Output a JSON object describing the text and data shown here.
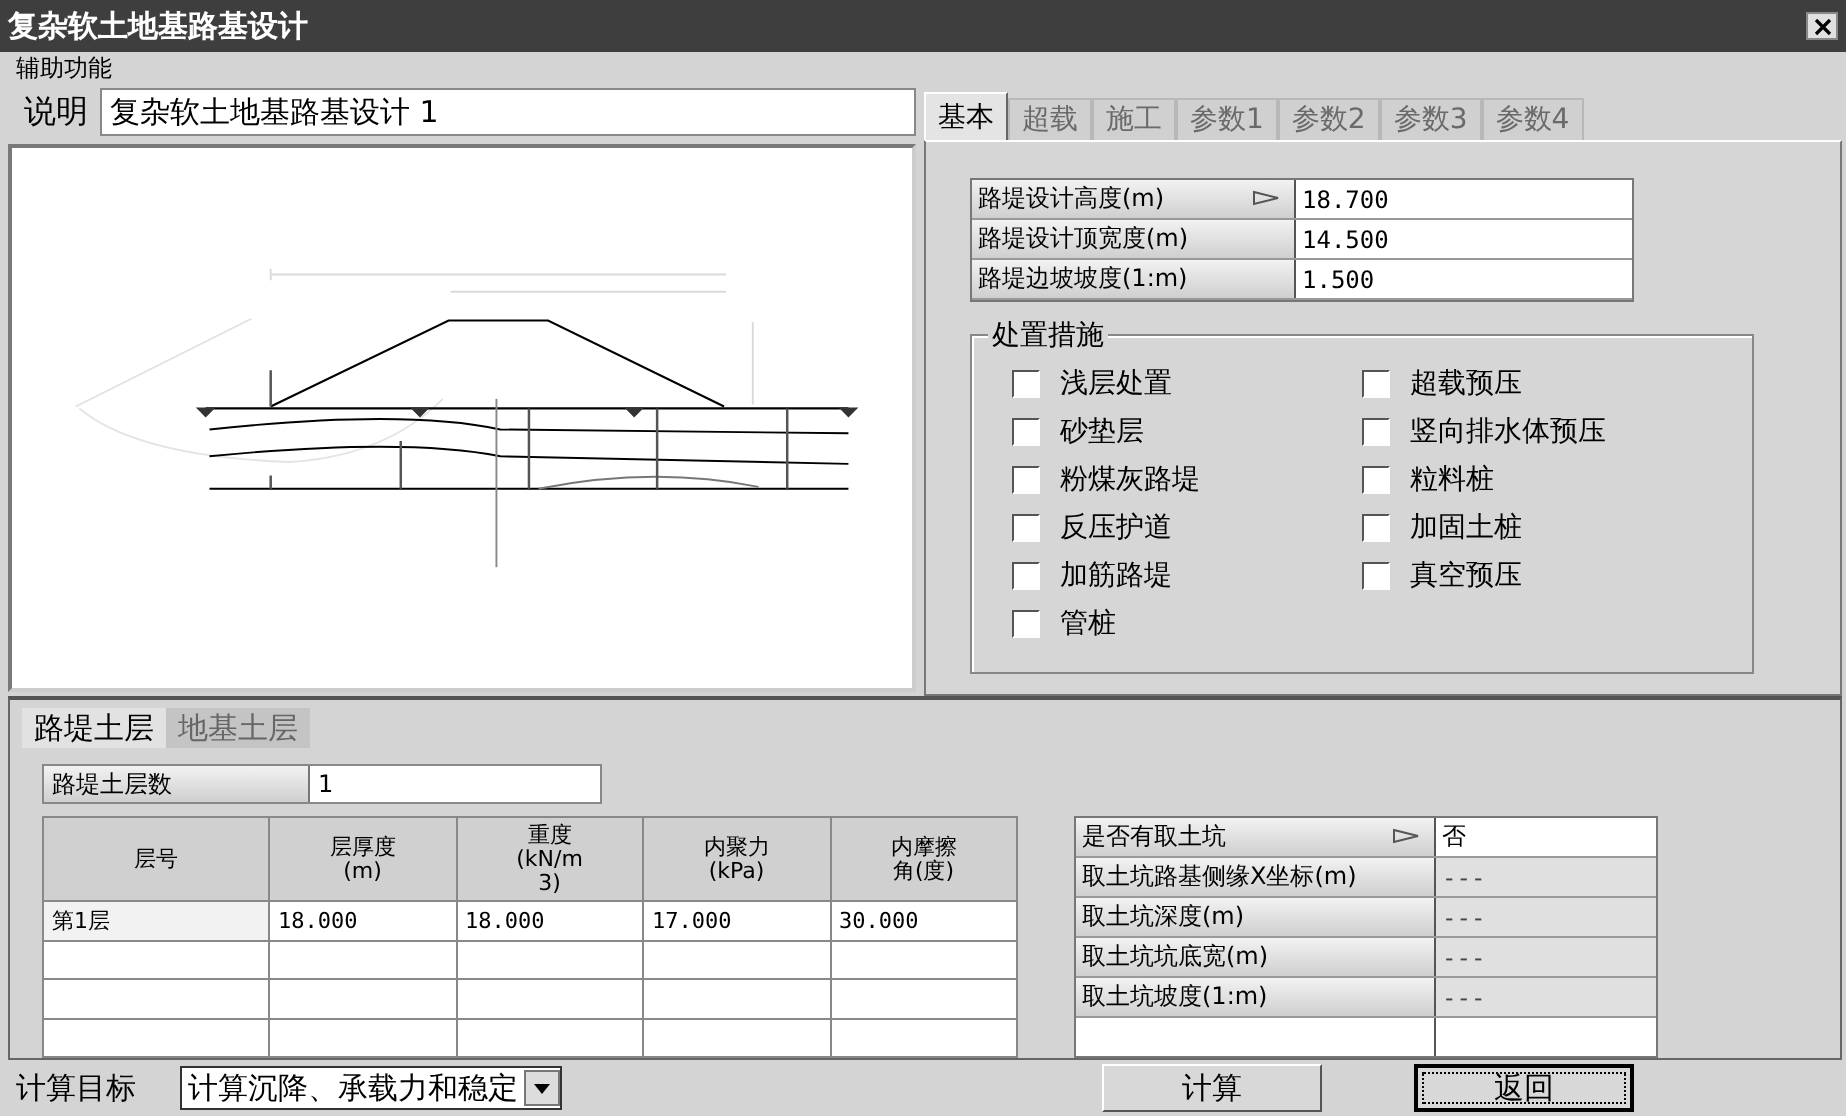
{
  "window": {
    "title": "复杂软土地基路基设计"
  },
  "menu": [
    "辅助功能"
  ],
  "description": {
    "label": "说明",
    "value": "复杂软土地基路基设计 1"
  },
  "param_tabs": [
    {
      "label": "基本",
      "selected": true
    },
    {
      "label": "超载",
      "selected": false
    },
    {
      "label": "施工",
      "selected": false
    },
    {
      "label": "参数1",
      "selected": false
    },
    {
      "label": "参数2",
      "selected": false
    },
    {
      "label": "参数3",
      "selected": false
    },
    {
      "label": "参数4",
      "selected": false
    }
  ],
  "basic_params": [
    {
      "label": "路堤设计高度(m)",
      "value": "18.700",
      "kind": "select"
    },
    {
      "label": "路堤设计顶宽度(m)",
      "value": "14.500",
      "kind": "input"
    },
    {
      "label": "路堤边坡坡度(1:m)",
      "value": "1.500",
      "kind": "input"
    }
  ],
  "treatment": {
    "title": "处置措施",
    "left": [
      {
        "label": "浅层处置",
        "checked": false
      },
      {
        "label": "砂垫层",
        "checked": false
      },
      {
        "label": "粉煤灰路堤",
        "checked": false
      },
      {
        "label": "反压护道",
        "checked": false
      },
      {
        "label": "加筋路堤",
        "checked": false
      },
      {
        "label": "管桩",
        "checked": false
      }
    ],
    "right": [
      {
        "label": "超载预压",
        "checked": false
      },
      {
        "label": "竖向排水体预压",
        "checked": false
      },
      {
        "label": "粒料桩",
        "checked": false
      },
      {
        "label": "加固土桩",
        "checked": false
      },
      {
        "label": "真空预压",
        "checked": false
      }
    ]
  },
  "layer_tabs": [
    {
      "label": "路堤土层",
      "selected": true
    },
    {
      "label": "地基土层",
      "selected": false
    }
  ],
  "layer_count": {
    "label": "路堤土层数",
    "value": "1"
  },
  "layer_table": {
    "columns": [
      "层号",
      "层厚度\n(m)",
      "重度\n(kN/m3)",
      "内聚力\n(kPa)",
      "内摩擦角(度)"
    ],
    "rows": [
      [
        "第1层",
        "18.000",
        "18.000",
        "17.000",
        "30.000"
      ]
    ]
  },
  "borrow_pit": [
    {
      "label": "是否有取土坑",
      "value": "否",
      "kind": "select"
    },
    {
      "label": "取土坑路基侧缘X坐标(m)",
      "value": "---",
      "kind": "readonly"
    },
    {
      "label": "取土坑深度(m)",
      "value": "---",
      "kind": "readonly"
    },
    {
      "label": "取土坑坑底宽(m)",
      "value": "---",
      "kind": "readonly"
    },
    {
      "label": "取土坑坡度(1:m)",
      "value": "---",
      "kind": "readonly"
    }
  ],
  "footer": {
    "target_label": "计算目标",
    "target_value": "计算沉降、承载力和稳定",
    "buttons": [
      {
        "label": "计算",
        "focused": false
      },
      {
        "label": "返回",
        "focused": true
      }
    ]
  }
}
